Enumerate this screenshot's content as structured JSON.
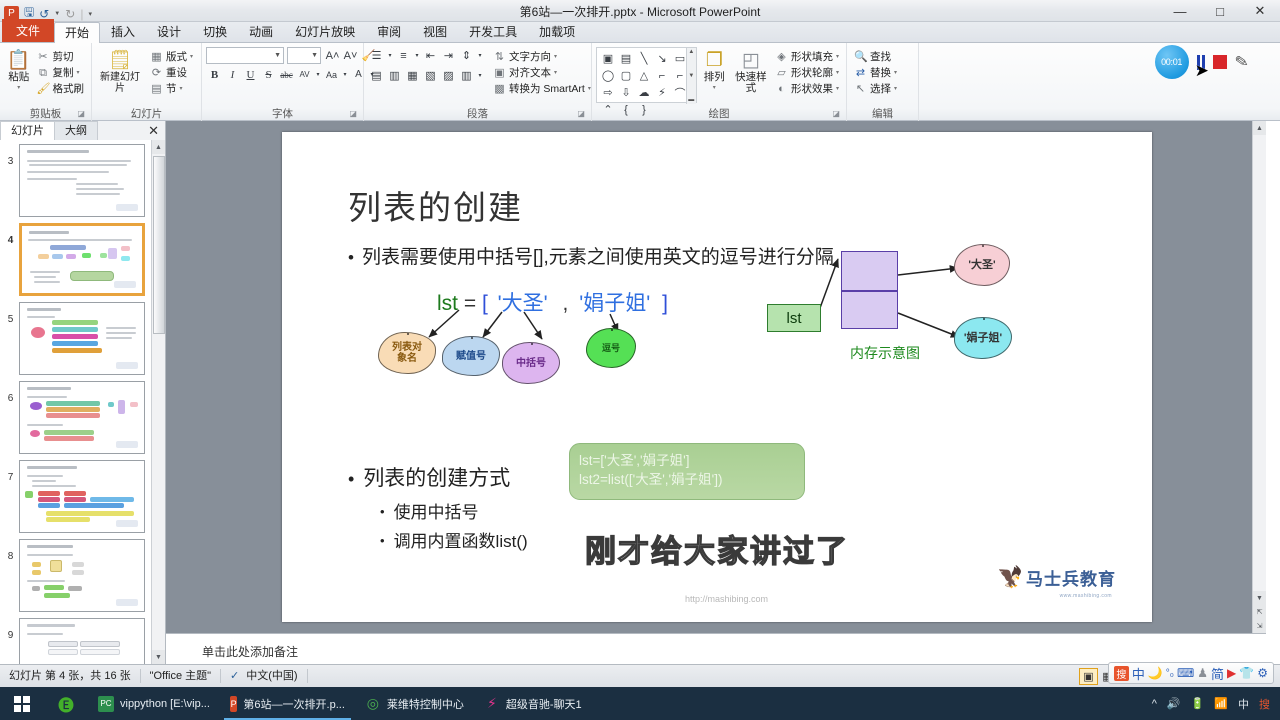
{
  "window": {
    "title": "第6站—一次排开.pptx - Microsoft PowerPoint",
    "qat": [
      "save-icon",
      "undo-icon",
      "redo-icon",
      "customize-icon"
    ],
    "minimize": "—",
    "maximize": "□",
    "close": "✕"
  },
  "ribbon": {
    "tabs": [
      {
        "label": "文件",
        "type": "file"
      },
      {
        "label": "开始",
        "active": true
      },
      {
        "label": "插入"
      },
      {
        "label": "设计"
      },
      {
        "label": "切换"
      },
      {
        "label": "动画"
      },
      {
        "label": "幻灯片放映"
      },
      {
        "label": "审阅"
      },
      {
        "label": "视图"
      },
      {
        "label": "开发工具"
      },
      {
        "label": "加载项"
      }
    ],
    "groups": [
      {
        "name": "剪贴板",
        "label": "剪贴板",
        "paste": "粘贴",
        "items": [
          {
            "label": "剪切",
            "icon": "scissors-icon"
          },
          {
            "label": "复制",
            "icon": "copy-icon"
          },
          {
            "label": "格式刷",
            "icon": "format-painter-icon"
          }
        ]
      },
      {
        "name": "幻灯片",
        "label": "幻灯片",
        "new_slide": "新建幻灯片",
        "items": [
          {
            "label": "版式",
            "icon": "layout-icon"
          },
          {
            "label": "重设",
            "icon": "reset-icon"
          },
          {
            "label": "节",
            "icon": "section-icon"
          }
        ]
      },
      {
        "name": "字体",
        "label": "字体",
        "font_name": "",
        "font_size": "",
        "buttons": [
          "B",
          "I",
          "U",
          "S",
          "abc",
          "AV",
          "Aa",
          "A"
        ]
      },
      {
        "name": "段落",
        "label": "段落",
        "items": [
          {
            "label": "文字方向",
            "icon": "text-direction-icon"
          },
          {
            "label": "对齐文本",
            "icon": "align-text-icon"
          },
          {
            "label": "转换为 SmartArt",
            "icon": "smartart-icon"
          }
        ]
      },
      {
        "name": "绘图",
        "label": "绘图",
        "arrange": "排列",
        "quick_styles": "快速样式",
        "items": [
          {
            "label": "形状填充",
            "icon": "shape-fill-icon"
          },
          {
            "label": "形状轮廓",
            "icon": "shape-outline-icon"
          },
          {
            "label": "形状效果",
            "icon": "shape-effects-icon"
          }
        ]
      },
      {
        "name": "编辑",
        "label": "编辑",
        "items": [
          {
            "label": "查找",
            "icon": "find-icon"
          },
          {
            "label": "替换",
            "icon": "replace-icon"
          },
          {
            "label": "选择",
            "icon": "select-icon"
          }
        ]
      }
    ]
  },
  "recorder": {
    "timer": "00:01",
    "pause": "pause-icon",
    "stop": "stop-icon",
    "pen": "pen-icon"
  },
  "thumbpanel": {
    "tabs": [
      {
        "label": "幻灯片",
        "active": true
      },
      {
        "label": "大纲",
        "active": false
      }
    ],
    "close": "✕",
    "slides": [
      {
        "num": "3",
        "selected": false
      },
      {
        "num": "4",
        "selected": true
      },
      {
        "num": "5",
        "selected": false
      },
      {
        "num": "6",
        "selected": false
      },
      {
        "num": "7",
        "selected": false
      },
      {
        "num": "8",
        "selected": false
      },
      {
        "num": "9",
        "selected": false
      }
    ]
  },
  "slide": {
    "title": "列表的创建",
    "bullet1": "列表需要使用中括号[],元素之间使用英文的逗号进行分隔",
    "expression": {
      "var": "lst",
      "equals": "=",
      "open": "[",
      "item1": "'大圣'",
      "comma": ",",
      "item2": "'娟子姐'",
      "close": "]"
    },
    "callouts": [
      {
        "label": "列表对象名",
        "color": "#f9dcb6"
      },
      {
        "label": "赋值号",
        "color": "#bcd7f0"
      },
      {
        "label": "中括号",
        "color": "#ddb5ef"
      },
      {
        "label": "逗号",
        "color": "#55e055"
      }
    ],
    "memory": {
      "var_box": "lst",
      "cloud1": "'大圣'",
      "cloud2": "'娟子姐'",
      "caption": "内存示意图"
    },
    "code": {
      "line1": "lst=['大圣','娟子姐']",
      "line2": "lst2=list(['大圣','娟子姐'])"
    },
    "bullet2": "列表的创建方式",
    "sub_bullets": [
      "使用中括号",
      "调用内置函数list()"
    ],
    "watermark": "http://mashibing.com",
    "logo_text": "马士兵教育",
    "logo_sub": "www.mashibing.com",
    "caption_overlay": "刚才给大家讲过了"
  },
  "notes": {
    "placeholder": "单击此处添加备注"
  },
  "statusbar": {
    "slide_count": "幻灯片 第 4 张，共 16 张",
    "theme": "\"Office 主题\"",
    "language": "中文(中国)",
    "spellcheck_icon": "spellcheck-icon",
    "views": [
      "normal-view-icon",
      "sorter-view-icon",
      "reading-view-icon",
      "show-view-icon"
    ],
    "zoom_out": "−",
    "zoom_in": "+",
    "zoom_level": "",
    "fit_icon": "fit-to-window-icon"
  },
  "ime": {
    "items": [
      "ime-logo",
      "中",
      "moon-icon",
      "tool-icon",
      "keyboard-icon",
      "pyramid-icon",
      "简",
      "video-icon",
      "shirt-icon",
      "gear-icon"
    ]
  },
  "taskbar": {
    "start": "start-icon",
    "items": [
      {
        "label": "",
        "icon": "edge-icon",
        "type": "icon-only"
      },
      {
        "label": "vippython [E:\\vip...",
        "icon": "pycharm-icon"
      },
      {
        "label": "第6站—一次排开.p...",
        "icon": "powerpoint-icon",
        "active": true
      },
      {
        "label": "莱维特控制中心",
        "icon": "lewitt-icon"
      },
      {
        "label": "超级音驰-聊天1",
        "icon": "chat-icon"
      }
    ],
    "tray": [
      "^",
      "speaker-icon",
      "battery-icon",
      "wifi-icon",
      "中",
      "ime-icon"
    ]
  }
}
